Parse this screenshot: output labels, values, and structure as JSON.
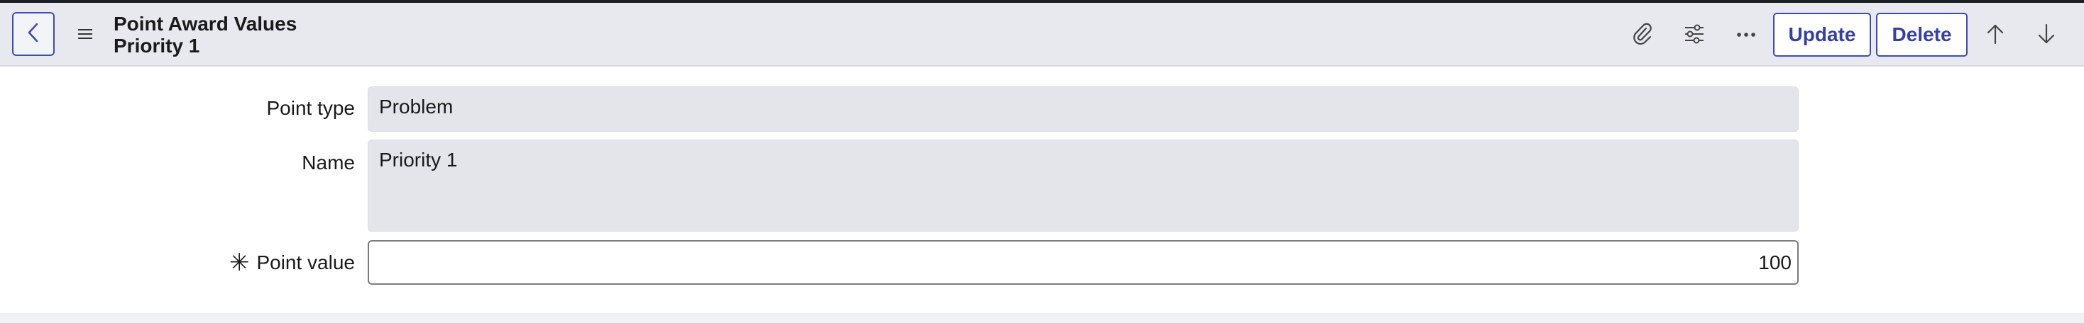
{
  "header": {
    "title": "Point Award Values",
    "subtitle": "Priority 1",
    "buttons": {
      "update": "Update",
      "delete": "Delete"
    },
    "icons": [
      "back-icon",
      "menu-icon",
      "paperclip-icon",
      "settings-sliders-icon",
      "more-icon",
      "arrow-up-icon",
      "arrow-down-icon"
    ]
  },
  "form": {
    "point_type": {
      "label": "Point type",
      "value": "Problem"
    },
    "name": {
      "label": "Name",
      "value": "Priority 1"
    },
    "point_value": {
      "label": "Point value",
      "value": "100",
      "required_mark": "✳"
    }
  },
  "colors": {
    "accent": "#3f4ab8",
    "header_bg": "#e8e9ee",
    "readonly_bg": "#e4e5ea"
  }
}
